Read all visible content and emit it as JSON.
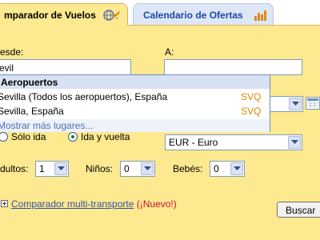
{
  "tabs": {
    "active_label": "mparador de Vuelos",
    "inactive_label": "Calendario de Ofertas",
    "active_icon": "plane-globe-icon",
    "inactive_icon": "bar-chart-icon"
  },
  "form": {
    "desde_label": "esde:",
    "desde_value": "evil",
    "a_label": "A:",
    "a_value": "",
    "trip": {
      "solo_ida": "Sólo ida",
      "ida_y_vuelta": "Ida y vuelta",
      "selected": "ida_y_vuelta"
    },
    "currency": "EUR - Euro",
    "adultos_label": "dultos:",
    "adultos_value": "1",
    "ninos_label": "Niños:",
    "ninos_value": "0",
    "bebes_label": "Bebés:",
    "bebes_value": "0"
  },
  "suggestions": {
    "header": "Aeropuertos",
    "items": [
      {
        "city": "Sevilla (Todos los aeropuertos), España",
        "code": "SVQ"
      },
      {
        "city": "Sevilla, España",
        "code": "SVQ"
      }
    ],
    "more": "Mostrar más lugares..."
  },
  "footer": {
    "multi_link": "Comparador multi-transporte",
    "new_label": "(¡Nuevo!)",
    "search_button": "Buscar"
  },
  "colors": {
    "panel": "#fde98f",
    "inactive_tab": "#dde7f7",
    "link": "#3450a8",
    "code": "#d98a00",
    "new": "#c8102e"
  }
}
